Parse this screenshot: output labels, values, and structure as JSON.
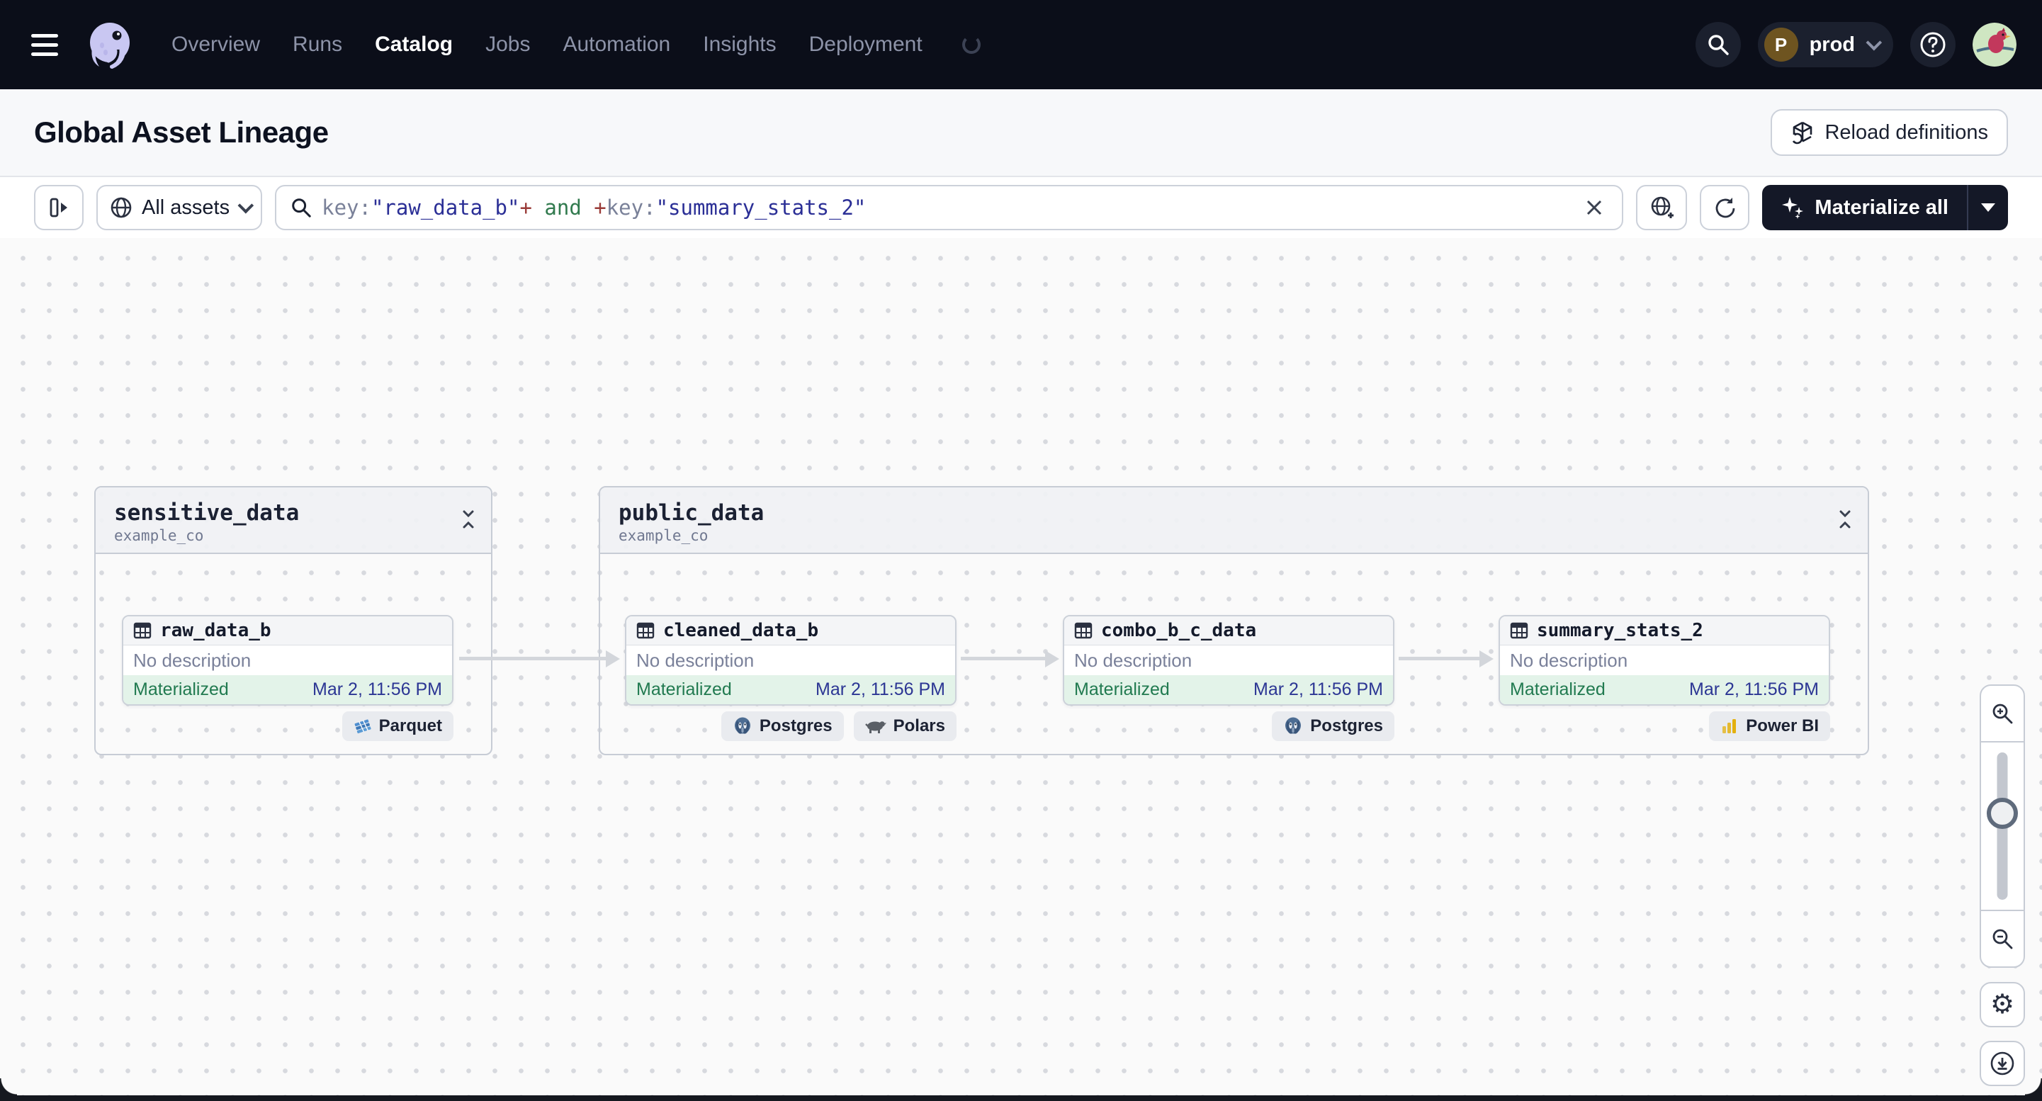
{
  "nav": {
    "items": [
      {
        "label": "Overview"
      },
      {
        "label": "Runs"
      },
      {
        "label": "Catalog"
      },
      {
        "label": "Jobs"
      },
      {
        "label": "Automation"
      },
      {
        "label": "Insights"
      },
      {
        "label": "Deployment"
      }
    ],
    "active_item": "Catalog",
    "environment": {
      "initial": "P",
      "label": "prod"
    }
  },
  "header": {
    "title": "Global Asset Lineage",
    "reload_button_label": "Reload definitions"
  },
  "toolbar": {
    "scope_button_label": "All assets",
    "materialize_button_label": "Materialize all",
    "search": {
      "tokens": [
        {
          "kind": "field",
          "text": "key:"
        },
        {
          "kind": "value",
          "text": "\"raw_data_b\""
        },
        {
          "kind": "op",
          "text": "+"
        },
        {
          "kind": "logic",
          "text": " and "
        },
        {
          "kind": "op",
          "text": "+"
        },
        {
          "kind": "field",
          "text": "key:"
        },
        {
          "kind": "value",
          "text": "\"summary_stats_2\""
        }
      ]
    }
  },
  "graph": {
    "groups": [
      {
        "name": "sensitive_data",
        "location": "example_co"
      },
      {
        "name": "public_data",
        "location": "example_co"
      }
    ],
    "nodes": [
      {
        "name": "raw_data_b",
        "description": "No description",
        "status": "Materialized",
        "materialized_at": "Mar 2, 11:56 PM",
        "tags": [
          {
            "label": "Parquet"
          }
        ]
      },
      {
        "name": "cleaned_data_b",
        "description": "No description",
        "status": "Materialized",
        "materialized_at": "Mar 2, 11:56 PM",
        "tags": [
          {
            "label": "Postgres"
          },
          {
            "label": "Polars"
          }
        ]
      },
      {
        "name": "combo_b_c_data",
        "description": "No description",
        "status": "Materialized",
        "materialized_at": "Mar 2, 11:56 PM",
        "tags": [
          {
            "label": "Postgres"
          }
        ]
      },
      {
        "name": "summary_stats_2",
        "description": "No description",
        "status": "Materialized",
        "materialized_at": "Mar 2, 11:56 PM",
        "tags": [
          {
            "label": "Power BI"
          }
        ]
      }
    ]
  },
  "colors": {
    "nav_bg": "#0b0e19",
    "status_materialized_bg": "#e3f3e9",
    "status_materialized_text": "#217a50",
    "timestamp_text": "#2c3694",
    "accent_dark": "#141827",
    "token_field": "#7a8199",
    "token_value": "#2b2f96",
    "token_op": "#9a3b38",
    "token_logic": "#317a4e"
  },
  "icons": {
    "gear": "⚙"
  }
}
